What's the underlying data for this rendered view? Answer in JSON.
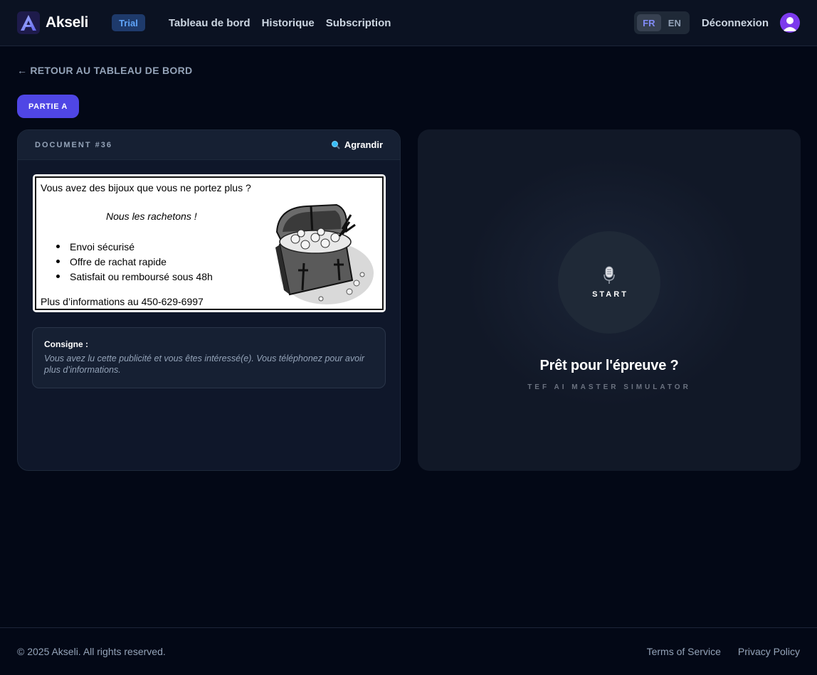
{
  "header": {
    "app_name": "Akseli",
    "logo_letter": "A",
    "badge": "Trial",
    "nav": [
      "Tableau de bord",
      "Historique",
      "Subscription"
    ],
    "languages": [
      {
        "code": "FR",
        "active": true
      },
      {
        "code": "EN",
        "active": false
      }
    ],
    "logout": "Déconnexion"
  },
  "back_link": "RETOUR AU TABLEAU DE BORD",
  "back_arrow": "←",
  "part_button": "PARTIE A",
  "document": {
    "label": "DOCUMENT #36",
    "expand_label": "Agrandir",
    "expand_icon": "magnifier-icon",
    "ad": {
      "headline": "Vous avez des bijoux que vous ne portez plus ?",
      "slogan": "Nous les rachetons !",
      "bullets": [
        "Envoi sécurisé",
        "Offre de rachat rapide",
        "Satisfait ou remboursé sous 48h"
      ],
      "info": "Plus d’informations au 450-629-6997",
      "image": "treasure-chest"
    },
    "instruction": {
      "title": "Consigne :",
      "text": "Vous avez lu cette publicité et vous êtes intéressé(e). Vous téléphonez pour avoir plus d’informations."
    }
  },
  "recorder": {
    "start_label": "START",
    "icon": "microphone-icon",
    "heading": "Prêt pour l'épreuve ?",
    "subheading": "TEF AI MASTER SIMULATOR"
  },
  "footer": {
    "copyright": "© 2025 Akseli. All rights reserved.",
    "links": [
      "Terms of Service",
      "Privacy Policy"
    ]
  },
  "colors": {
    "background": "#030816",
    "accent": "#4f46e5",
    "badge_bg": "#1e3a6b",
    "badge_text": "#60a5fa",
    "avatar": "#7c3aed"
  }
}
